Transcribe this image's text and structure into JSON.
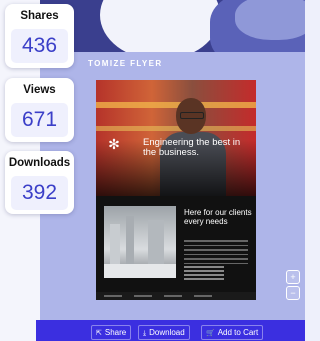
{
  "stats": [
    {
      "label": "Shares",
      "value": "436"
    },
    {
      "label": "Views",
      "value": "671"
    },
    {
      "label": "Downloads",
      "value": "392"
    }
  ],
  "panel": {
    "title": "TOMIZE FLYER"
  },
  "flyer": {
    "logo_icon": "snowflake-icon",
    "headline": "Engineering the best in the business.",
    "subheadline": "Here for our clients every needs"
  },
  "zoom": {
    "in_icon": "zoom-in-icon",
    "out_icon": "zoom-out-icon"
  },
  "actions": {
    "share_label": "Share",
    "download_label": "Download",
    "cart_label": "Add to Cart"
  },
  "colors": {
    "accent": "#3b2fe0",
    "panel": "#aeb5e9",
    "stat_value": "#3b3fc8"
  }
}
